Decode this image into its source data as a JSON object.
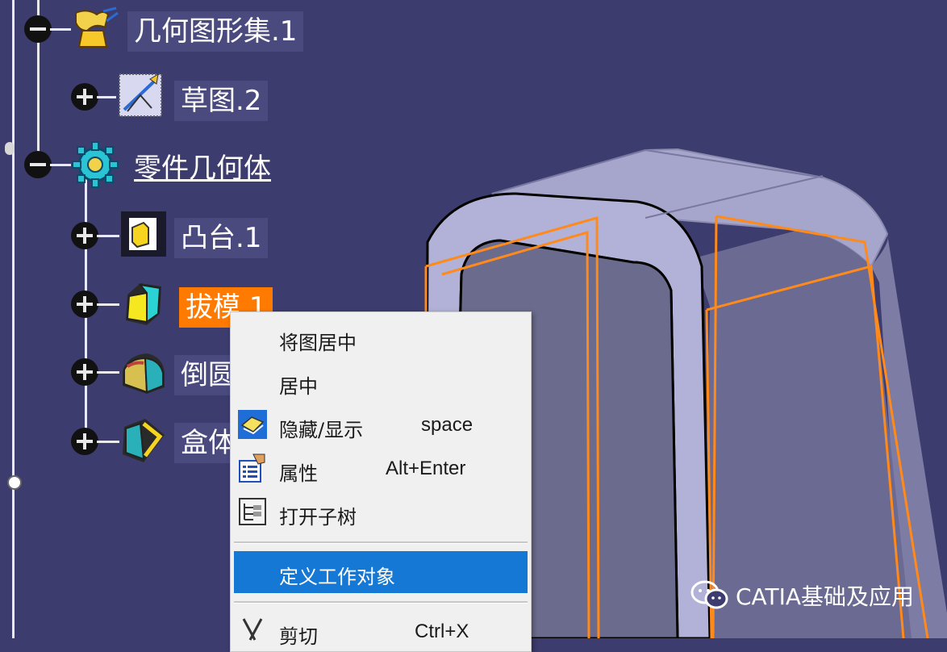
{
  "tree": {
    "nodes": [
      {
        "label": "几何图形集.1",
        "state": "expanded",
        "icon": "geometrical-set-icon"
      },
      {
        "label": "草图.2",
        "state": "collapsed",
        "icon": "sketch-icon"
      },
      {
        "label": "零件几何体",
        "state": "expanded",
        "icon": "part-body-icon"
      },
      {
        "label": "凸台.1",
        "state": "collapsed",
        "icon": "pad-icon"
      },
      {
        "label": "拔模.1",
        "state": "collapsed",
        "icon": "draft-icon",
        "selected": true
      },
      {
        "label": "倒圆",
        "state": "collapsed",
        "icon": "fillet-icon"
      },
      {
        "label": "盒体",
        "state": "collapsed",
        "icon": "shell-icon"
      }
    ]
  },
  "context_menu": {
    "items": [
      {
        "label": "将图居中",
        "shortcut": ""
      },
      {
        "label": "居中",
        "shortcut": ""
      },
      {
        "label": "隐藏/显示",
        "shortcut": "space",
        "icon": "hide-show-icon"
      },
      {
        "label": "属性",
        "shortcut": "Alt+Enter",
        "icon": "properties-icon"
      },
      {
        "label": "打开子树",
        "shortcut": "",
        "icon": "open-subtree-icon"
      },
      {
        "label": "定义工作对象",
        "shortcut": "",
        "highlighted": true
      },
      {
        "label": "剪切",
        "shortcut": "Ctrl+X",
        "icon": "cut-icon"
      }
    ]
  },
  "watermark": {
    "text": "CATIA基础及应用",
    "icon": "wechat-icon"
  },
  "colors": {
    "background": "#3d3c6e",
    "selection": "#ff7a00",
    "menu_highlight": "#1478d4",
    "model_face": "#9f9fc4",
    "edge_highlight": "#ff8a1c"
  }
}
